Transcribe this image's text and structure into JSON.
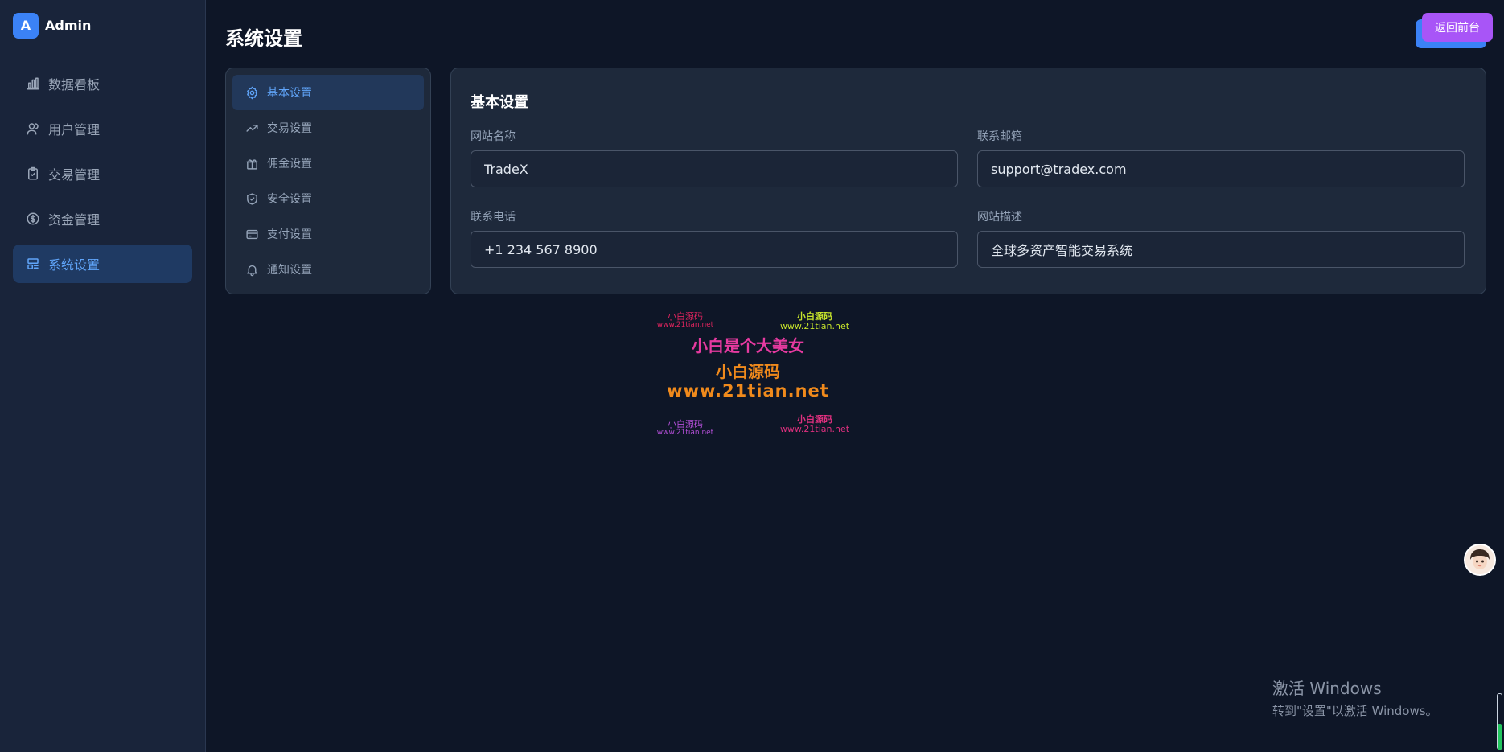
{
  "brand": {
    "logo_letter": "A",
    "name": "Admin"
  },
  "sidebar": {
    "items": [
      {
        "label": "数据看板",
        "icon": "bar-chart-icon",
        "active": false
      },
      {
        "label": "用户管理",
        "icon": "users-icon",
        "active": false
      },
      {
        "label": "交易管理",
        "icon": "clipboard-check-icon",
        "active": false
      },
      {
        "label": "资金管理",
        "icon": "dollar-circle-icon",
        "active": false
      },
      {
        "label": "系统设置",
        "icon": "layout-icon",
        "active": true
      }
    ]
  },
  "header": {
    "title": "系统设置",
    "back_button": "返回前台"
  },
  "settings_menu": {
    "items": [
      {
        "label": "基本设置",
        "icon": "gear-icon",
        "active": true
      },
      {
        "label": "交易设置",
        "icon": "trending-up-icon",
        "active": false
      },
      {
        "label": "佣金设置",
        "icon": "gift-icon",
        "active": false
      },
      {
        "label": "安全设置",
        "icon": "shield-check-icon",
        "active": false
      },
      {
        "label": "支付设置",
        "icon": "credit-card-icon",
        "active": false
      },
      {
        "label": "通知设置",
        "icon": "bell-icon",
        "active": false
      }
    ]
  },
  "basic_settings": {
    "title": "基本设置",
    "fields": {
      "site_name": {
        "label": "网站名称",
        "value": "TradeX"
      },
      "contact_email": {
        "label": "联系邮箱",
        "value": "support@tradex.com"
      },
      "contact_phone": {
        "label": "联系电话",
        "value": "+1 234 567 8900"
      },
      "site_description": {
        "label": "网站描述",
        "value": "全球多资产智能交易系统"
      }
    }
  },
  "watermark": {
    "top_left_name": "小白源码",
    "top_left_url": "www.21tian.net",
    "top_right_name": "小白源码",
    "top_right_url": "www.21tian.net",
    "center_line": "小白是个大美女",
    "center_name": "小白源码",
    "center_url": "www.21tian.net",
    "bottom_left_name": "小白源码",
    "bottom_left_url": "www.21tian.net",
    "bottom_right_name": "小白源码",
    "bottom_right_url": "www.21tian.net"
  },
  "os_overlay": {
    "activate_title": "激活 Windows",
    "activate_sub": "转到\"设置\"以激活 Windows。"
  },
  "colors": {
    "background": "#0e1627",
    "sidebar": "#19243a",
    "accent": "#3b82f6",
    "active_text": "#60a5fa",
    "back_button": "#a855f7"
  }
}
